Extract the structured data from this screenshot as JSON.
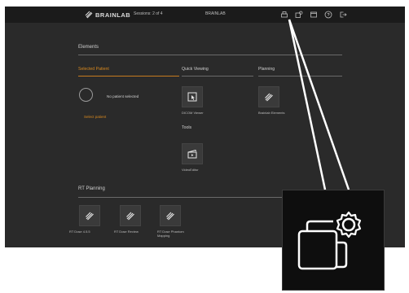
{
  "header": {
    "brand": "BRAINLAB",
    "session": "Sessions: 2 of 4",
    "title": "BRAINLAB",
    "icons": [
      "print-icon",
      "content-settings-icon",
      "window-icon",
      "help-icon",
      "logout-icon"
    ]
  },
  "elements": {
    "title": "Elements",
    "columns": {
      "selected_patient": "Selected Patient",
      "quick_viewing": "Quick Viewing",
      "planning": "Planning",
      "tools": "Tools"
    },
    "no_patient": "No patient selected",
    "select_patient": "Select patient",
    "tiles": {
      "dicom_viewer": "DICOM Viewer",
      "brainlab_elements": "Brainlab Elements",
      "video_edit": "VideoEditor"
    }
  },
  "rt_planning": {
    "title": "RT Planning",
    "tiles": [
      "RT Dose 4.5.5",
      "RT Dose Review",
      "RT Dose Phantom Mapping"
    ]
  },
  "colors": {
    "accent": "#d7881f",
    "app_bg": "#2a2a2a",
    "topbar_bg": "#1b1b1b"
  }
}
